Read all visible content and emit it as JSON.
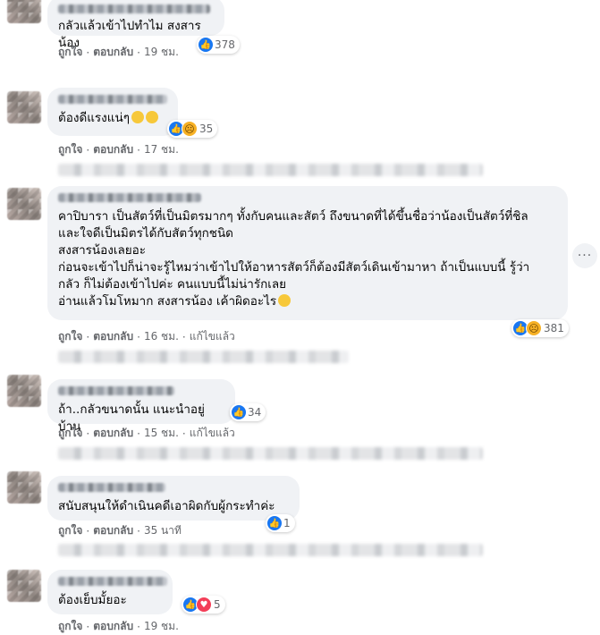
{
  "comments": [
    {
      "text": "กลัวแล้วเข้าไปทำไม สงสารน้อง",
      "reaction_count": "378",
      "reactions": [
        "like-icon"
      ],
      "like_label": "ถูกใจ",
      "reply_label": "ตอบกลับ",
      "time": "19 ชม.",
      "edited": ""
    },
    {
      "text": "ต้องดีแรงแน่ๆ",
      "emojis": [
        "grin-emoji",
        "grin-emoji"
      ],
      "reaction_count": "35",
      "reactions": [
        "like-icon",
        "sad-icon"
      ],
      "like_label": "ถูกใจ",
      "reply_label": "ตอบกลับ",
      "time": "17 ชม.",
      "edited": ""
    },
    {
      "text": "คาปิบารา เป็นสัตว์ที่เป็นมิตรมากๆ ทั้งกับคนและสัตว์ ถึงขนาดที่ได้ขึ้นชื่อว่าน้องเป็นสัตว์ที่ชิล\nและใจดีเป็นมิตรได้กับสัตว์ทุกชนิด\nสงสารน้องเลยอะ\nก่อนจะเข้าไปก็น่าจะรู้ไหมว่าเข้าไปให้อาหารสัตว์ก็ต้องมีสัตว์เดินเข้ามาหา ถ้าเป็นแบบนี้ รู้ว่า\nกลัว ก็ไม่ต้องเข้าไปค่ะ คนแบบนี้ไม่น่ารักเลย\nอ่านแล้วโมโหมาก สงสารน้อง เค้าผิดอะไร",
      "emojis": [
        "sad-emoji"
      ],
      "reaction_count": "381",
      "reactions": [
        "like-icon",
        "sad-icon"
      ],
      "like_label": "ถูกใจ",
      "reply_label": "ตอบกลับ",
      "time": "16 ชม.",
      "edited": "แก้ไขแล้ว"
    },
    {
      "text": "ถ้า..กลัวขนาดนั้น แนะนำอยู่บ้าน",
      "reaction_count": "34",
      "reactions": [
        "like-icon"
      ],
      "like_label": "ถูกใจ",
      "reply_label": "ตอบกลับ",
      "time": "15 ชม.",
      "edited": "แก้ไขแล้ว"
    },
    {
      "text": "สนับสนุนให้ดำเนินคดีเอาผิดกับผู้กระทำค่ะ",
      "reaction_count": "1",
      "reactions": [
        "like-icon"
      ],
      "like_label": "ถูกใจ",
      "reply_label": "ตอบกลับ",
      "time": "35 นาที",
      "edited": ""
    },
    {
      "text": "ต้องเย็บมั้ยอะ",
      "reaction_count": "5",
      "reactions": [
        "like-icon",
        "love-icon"
      ],
      "like_label": "ถูกใจ",
      "reply_label": "ตอบกลับ",
      "time": "19 ชม.",
      "edited": ""
    }
  ],
  "more_button": "···",
  "colors": {
    "bubble": "#f0f2f5",
    "like": "#1877f2",
    "sad": "#f7b125",
    "love": "#f33e58",
    "meta_text": "#65676b"
  }
}
